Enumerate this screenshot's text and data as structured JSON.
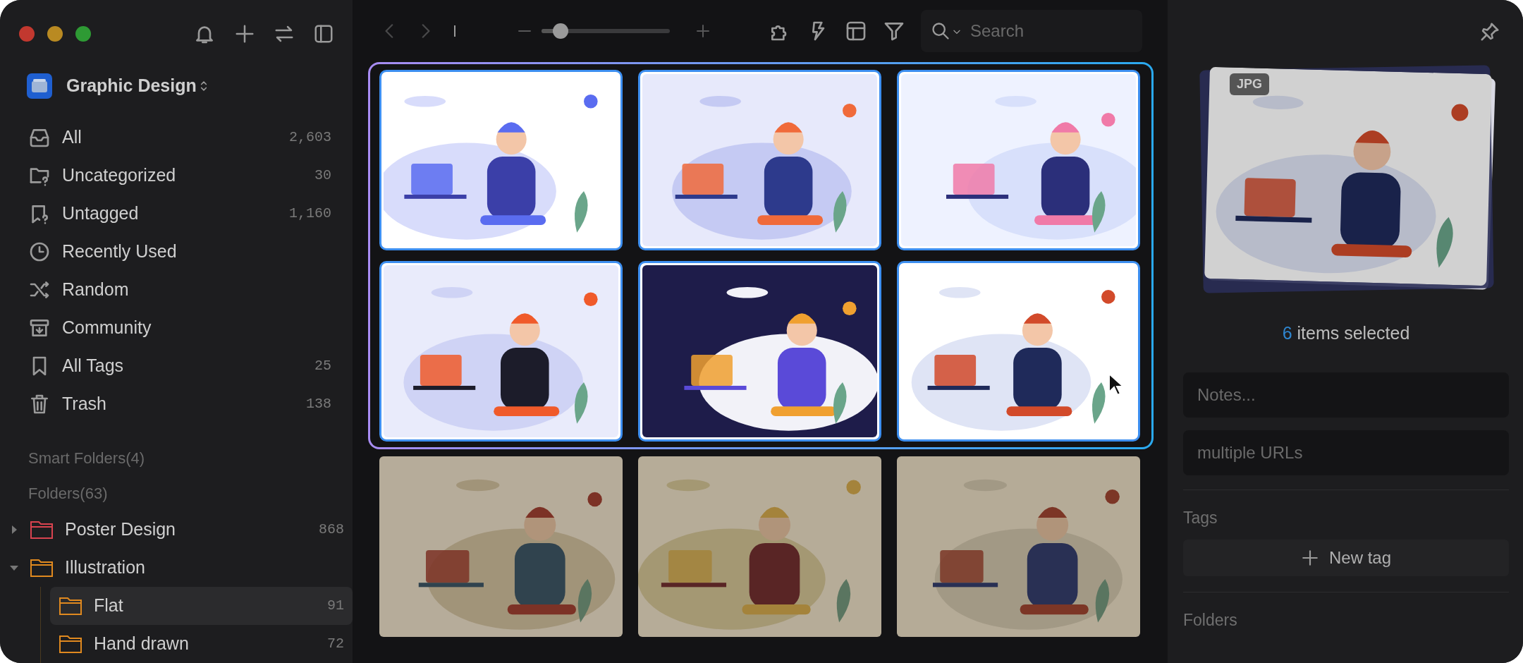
{
  "library": {
    "name": "Graphic Design"
  },
  "sidebar": {
    "items": [
      {
        "kind": "all",
        "label": "All",
        "count": "2,603"
      },
      {
        "kind": "uncategorized",
        "label": "Uncategorized",
        "count": "30"
      },
      {
        "kind": "untagged",
        "label": "Untagged",
        "count": "1,160"
      },
      {
        "kind": "recent",
        "label": "Recently Used"
      },
      {
        "kind": "random",
        "label": "Random"
      },
      {
        "kind": "community",
        "label": "Community"
      },
      {
        "kind": "tags",
        "label": "All Tags",
        "count": "25"
      },
      {
        "kind": "trash",
        "label": "Trash",
        "count": "138"
      }
    ],
    "smart_folders": {
      "label": "Smart Folders(4)"
    },
    "folders": {
      "label": "Folders(63)",
      "items": [
        {
          "label": "Poster Design",
          "count": "868",
          "color": "#d8434f",
          "expanded": false,
          "selected": false
        },
        {
          "label": "Illustration",
          "color": "#e0891f",
          "expanded": true,
          "selected": false,
          "children": [
            {
              "label": "Flat",
              "count": "91",
              "color": "#e0891f",
              "selected": true
            },
            {
              "label": "Hand drawn",
              "count": "72",
              "color": "#e0891f",
              "selected": false
            }
          ]
        }
      ]
    }
  },
  "toolbar": {
    "zoom": {
      "level": 0.15
    },
    "search": {
      "placeholder": "Search"
    }
  },
  "grid": {
    "items": [
      {
        "kind": "picture",
        "selected": true
      },
      {
        "kind": "picture",
        "selected": true
      },
      {
        "kind": "picture",
        "selected": true
      },
      {
        "kind": "picture",
        "selected": true
      },
      {
        "kind": "picture",
        "selected": true
      },
      {
        "kind": "picture",
        "selected": true
      },
      {
        "kind": "picture",
        "selected": false
      },
      {
        "kind": "picture",
        "selected": false
      },
      {
        "kind": "picture",
        "selected": false
      }
    ]
  },
  "inspector": {
    "preview_badge": "JPG",
    "selection_count": "6",
    "selection_label": "items selected",
    "notes": {
      "placeholder": "Notes..."
    },
    "urls": {
      "placeholder": "multiple URLs"
    },
    "tags": {
      "title": "Tags",
      "button": "New tag"
    },
    "folders": {
      "title": "Folders"
    }
  }
}
